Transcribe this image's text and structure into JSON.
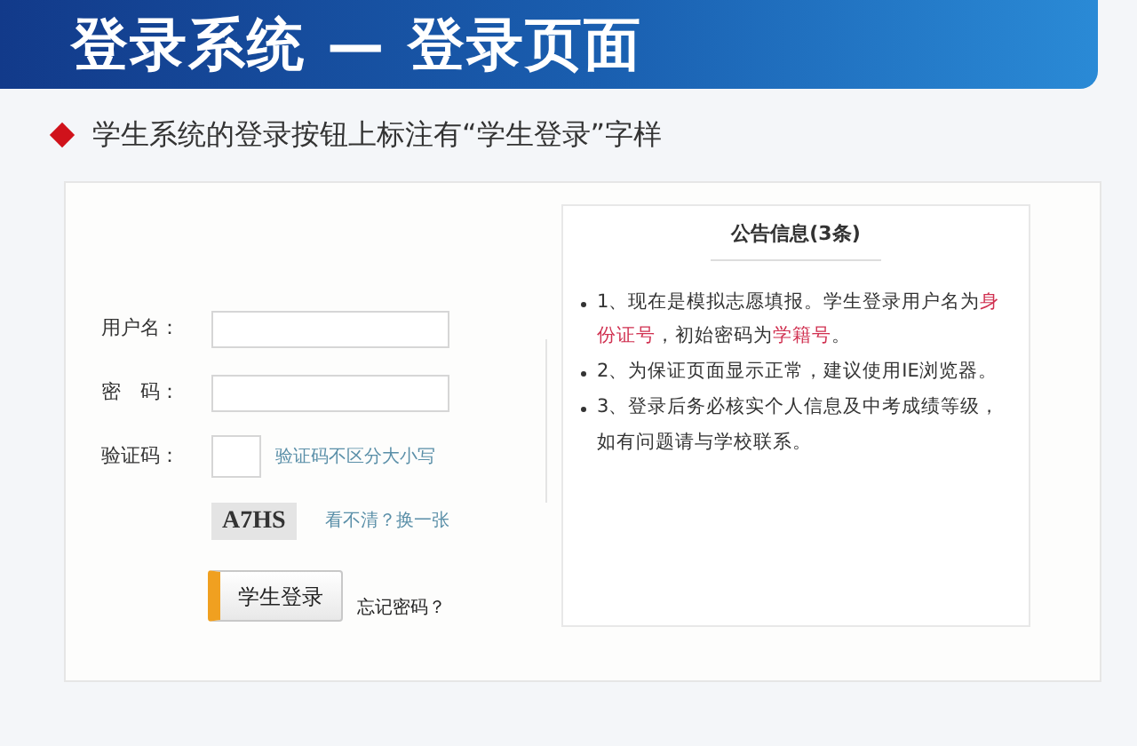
{
  "slide": {
    "title": "登录系统 — 登录页面",
    "bullet": "学生系统的登录按钮上标注有“学生登录”字样"
  },
  "login_form": {
    "fields": [
      {
        "label": "用户名：",
        "kind": "text"
      },
      {
        "label": "密　码：",
        "kind": "text"
      },
      {
        "label": "验证码：",
        "kind": "captcha",
        "hint": "验证码不区分大小写"
      }
    ],
    "captcha_image": "A7HS",
    "refresh_link": "看不清？换一张",
    "login_button": "学生登录",
    "forgot_link": "忘记密码？"
  },
  "notice": {
    "title": "公告信息(3条)",
    "items": [
      [
        {
          "text": "1、现在是模拟志愿填报。学生登录用户名为",
          "highlight": false
        },
        {
          "text": "身份证号",
          "highlight": true
        },
        {
          "text": "，初始密码为",
          "highlight": false
        },
        {
          "text": "学籍号",
          "highlight": true
        },
        {
          "text": "。",
          "highlight": false
        }
      ],
      [
        {
          "text": "2、为保证页面显示正常，建议使用IE浏览器。",
          "highlight": false
        }
      ],
      [
        {
          "text": "3、登录后务必核实个人信息及中考成绩等级，如有问题请与学校联系。",
          "highlight": false
        }
      ]
    ]
  }
}
